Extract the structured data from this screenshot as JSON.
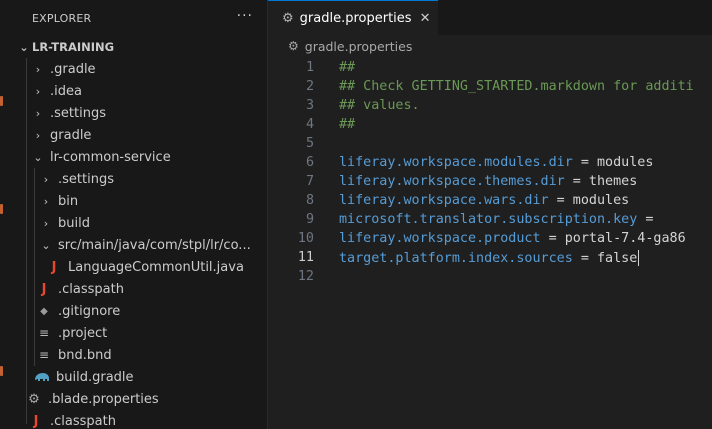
{
  "explorer": {
    "title": "EXPLORER",
    "more_label": "···",
    "root": "LR-TRAINING",
    "items": [
      {
        "label": ".gradle"
      },
      {
        "label": ".idea"
      },
      {
        "label": ".settings"
      },
      {
        "label": "gradle"
      },
      {
        "label": "lr-common-service"
      },
      {
        "label": ".settings"
      },
      {
        "label": "bin"
      },
      {
        "label": "build"
      },
      {
        "label": "src/main/java/com/stpl/lr/co..."
      },
      {
        "label": "LanguageCommonUtil.java"
      },
      {
        "label": ".classpath"
      },
      {
        "label": ".gitignore"
      },
      {
        "label": ".project"
      },
      {
        "label": "bnd.bnd"
      },
      {
        "label": "build.gradle"
      },
      {
        "label": ".blade.properties"
      },
      {
        "label": ".classpath"
      }
    ]
  },
  "editor": {
    "tab_label": "gradle.properties",
    "breadcrumb": "gradle.properties",
    "lines": [
      {
        "num": "1",
        "comment": "##",
        "key": "",
        "eq": "",
        "value": ""
      },
      {
        "num": "2",
        "comment": "## Check GETTING_STARTED.markdown for additi",
        "key": "",
        "eq": "",
        "value": ""
      },
      {
        "num": "3",
        "comment": "## values.",
        "key": "",
        "eq": "",
        "value": ""
      },
      {
        "num": "4",
        "comment": "##",
        "key": "",
        "eq": "",
        "value": ""
      },
      {
        "num": "5",
        "comment": "",
        "key": "",
        "eq": "",
        "value": ""
      },
      {
        "num": "6",
        "comment": "",
        "key": "liferay.workspace.modules.dir",
        "eq": " = ",
        "value": "modules"
      },
      {
        "num": "7",
        "comment": "",
        "key": "liferay.workspace.themes.dir",
        "eq": " = ",
        "value": "themes"
      },
      {
        "num": "8",
        "comment": "",
        "key": "liferay.workspace.wars.dir",
        "eq": " = ",
        "value": "modules"
      },
      {
        "num": "9",
        "comment": "",
        "key": "microsoft.translator.subscription.key",
        "eq": " =",
        "value": ""
      },
      {
        "num": "10",
        "comment": "",
        "key": "liferay.workspace.product",
        "eq": " = ",
        "value": "portal-7.4-ga86"
      },
      {
        "num": "11",
        "comment": "",
        "key": "target.platform.index.sources",
        "eq": " = ",
        "value": "false"
      },
      {
        "num": "12",
        "comment": "",
        "key": "",
        "eq": "",
        "value": ""
      }
    ],
    "active_line": "11"
  }
}
